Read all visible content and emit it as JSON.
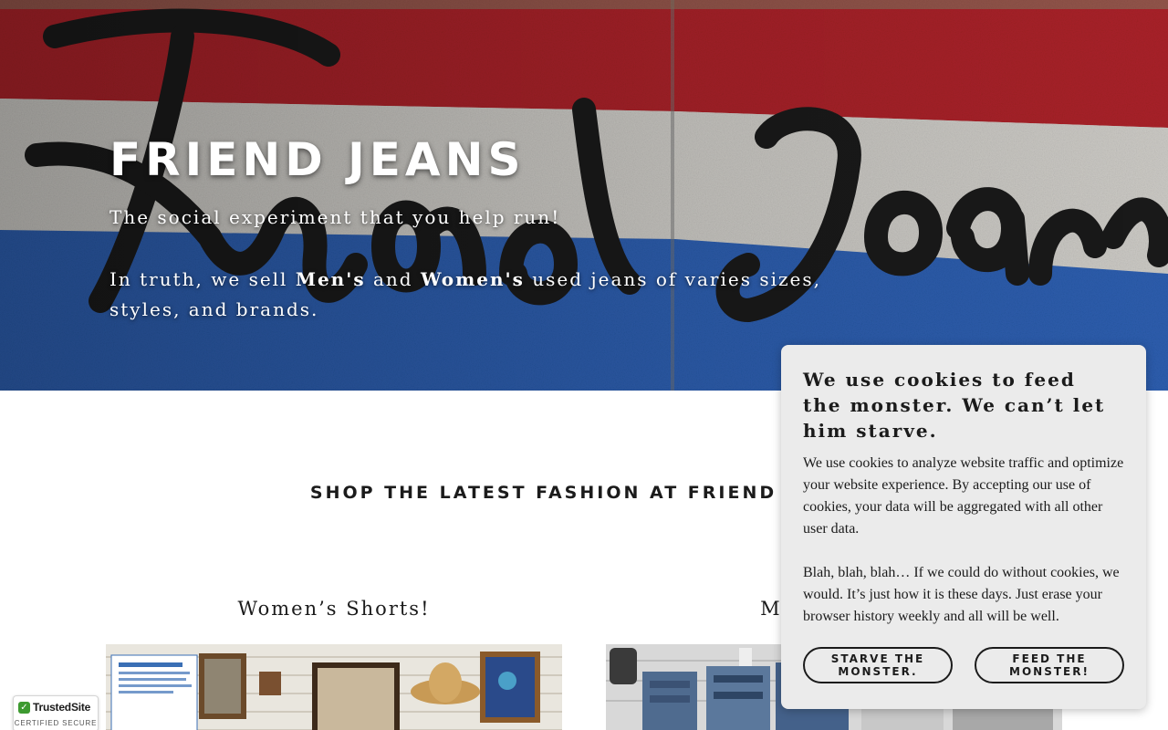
{
  "hero": {
    "title": "FRIEND JEANS",
    "tagline": "The social experiment that you help run!",
    "desc_before": "In truth, we sell ",
    "desc_mens": "Men's",
    "desc_and": " and ",
    "desc_womens": "Women's",
    "desc_after": " used jeans of varies sizes, styles, and brands.",
    "image_alt": "Friend Jeans sign painted red, white and blue"
  },
  "section": {
    "heading": "SHOP THE LATEST FASHION AT FRIEND JEANS",
    "products": [
      {
        "title": "Women’s Shorts!"
      },
      {
        "title": "Men’s Jeans!"
      }
    ]
  },
  "cookie": {
    "title": "We use cookies to feed the monster. We can’t let him starve.",
    "body_1": "We use cookies to analyze website traffic and optimize your website experience. By accepting our use of cookies, your data will be aggregated with all other user data.",
    "body_2": "Blah, blah, blah… If we could do without cookies, we would. It’s just how it is these days. Just erase your browser history weekly and all will be well.",
    "starve_label": "STARVE THE MONSTER.",
    "feed_label": "FEED THE MONSTER!"
  },
  "badge": {
    "name": "TrustedSite",
    "sub": "CERTIFIED SECURE",
    "icon": "check-icon"
  },
  "colors": {
    "text": "#1b1b1b",
    "dialog_bg": "#ebebeb",
    "flag_red": "#b3242b",
    "flag_blue": "#2f63b8",
    "badge_green": "#3d9a30"
  }
}
